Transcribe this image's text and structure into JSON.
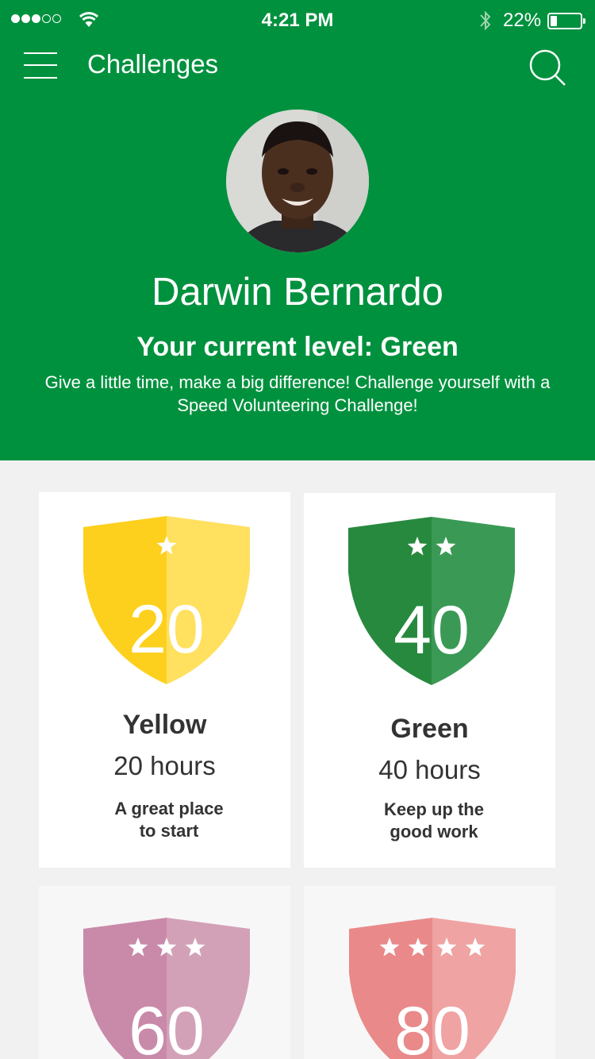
{
  "status_bar": {
    "time": "4:21 PM",
    "battery": "22%",
    "battery_level": 0.22,
    "signal_bars_filled": 3,
    "signal_bars_total": 5
  },
  "nav": {
    "title": "Challenges",
    "menu_icon": "hamburger-menu-icon",
    "search_icon": "search-icon"
  },
  "profile": {
    "name": "Darwin Bernardo",
    "level_title": "Your current level: Green",
    "description": "Give a little time, make a big difference! Challenge yourself with a Speed Volunteering Challenge!"
  },
  "colors": {
    "brand_green": "#00913e",
    "page_bg": "#f1f1f1"
  },
  "levels": [
    {
      "number": "20",
      "stars": 1,
      "name": "Yellow",
      "hours": "20 hours",
      "tagline_1": "A great place",
      "tagline_2": "to start",
      "color_left": "#fdd01e",
      "color_right": "#ffe05f"
    },
    {
      "number": "40",
      "stars": 2,
      "name": "Green",
      "hours": "40 hours",
      "tagline_1": "Keep up the",
      "tagline_2": "good work",
      "color_left": "#27893e",
      "color_right": "#3a9a55"
    },
    {
      "number": "60",
      "stars": 3,
      "color_left": "#c98aa9",
      "color_right": "#d3a1b7"
    },
    {
      "number": "80",
      "stars": 4,
      "color_left": "#e9898a",
      "color_right": "#efa3a2"
    }
  ]
}
